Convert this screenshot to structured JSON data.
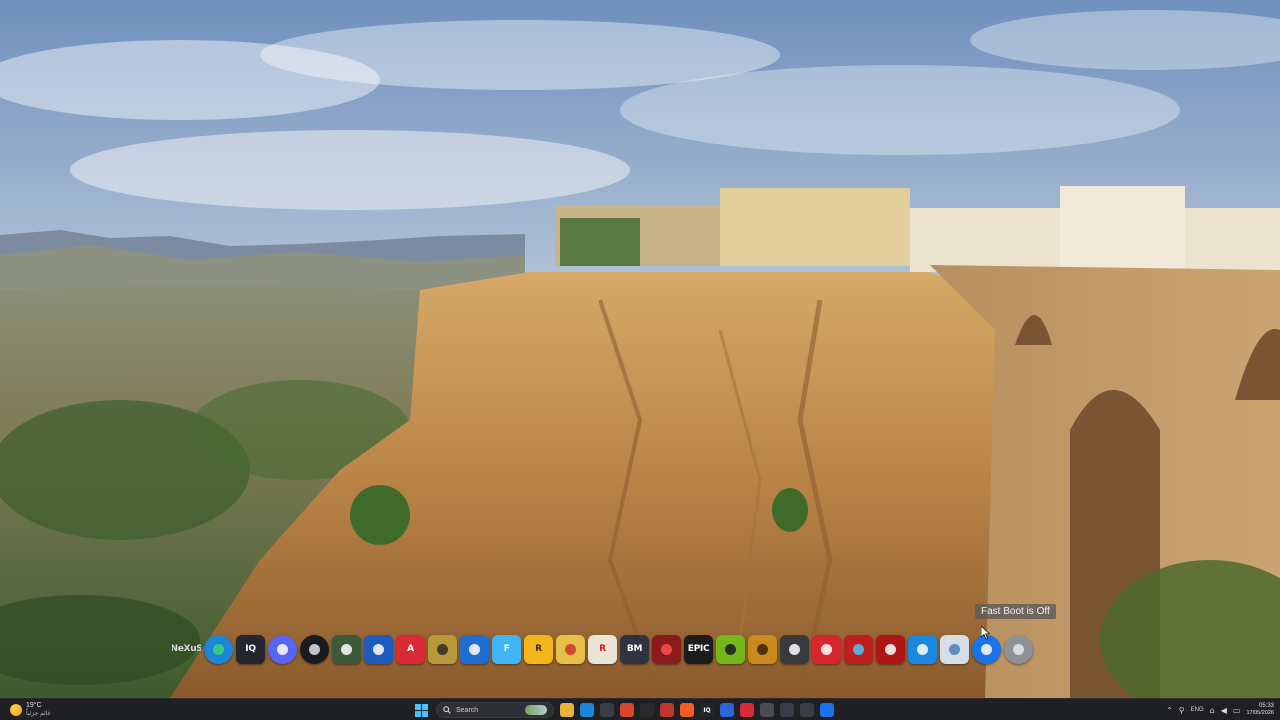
{
  "dock": {
    "tooltip": "Fast Boot is Off",
    "icons": [
      {
        "name": "nexus-logo-icon",
        "label": "NeXuS",
        "bg": "transparent",
        "fg": "#d8d8d8",
        "shape": "plain"
      },
      {
        "name": "edge-browser-icon",
        "label": "",
        "bg": "#1b86d6",
        "fg": "#3fd27a",
        "shape": "round"
      },
      {
        "name": "iq-app-icon",
        "label": "IQ",
        "bg": "#23262c",
        "fg": "#ffffff",
        "shape": "square"
      },
      {
        "name": "discord-icon",
        "label": "",
        "bg": "#5865f2",
        "fg": "#ffffff",
        "shape": "round"
      },
      {
        "name": "obs-studio-icon",
        "label": "",
        "bg": "#1b1b1f",
        "fg": "#e0e0e0",
        "shape": "round"
      },
      {
        "name": "game-mod-app-icon",
        "label": "",
        "bg": "#3d5a3a",
        "fg": "#ffffff",
        "shape": "square"
      },
      {
        "name": "rocket-league-icon",
        "label": "",
        "bg": "#1d5bbd",
        "fg": "#ffffff",
        "shape": "square"
      },
      {
        "name": "acrobat-icon",
        "label": "A",
        "bg": "#d92a35",
        "fg": "#ffffff",
        "shape": "square"
      },
      {
        "name": "game-folder-icon",
        "label": "",
        "bg": "#b79a3b",
        "fg": "#2e2b1c",
        "shape": "square"
      },
      {
        "name": "diagnostic-tool-icon",
        "label": "",
        "bg": "#1f6fd1",
        "fg": "#ffffff",
        "shape": "square"
      },
      {
        "name": "flutter-app-icon",
        "label": "F",
        "bg": "#42b6f5",
        "fg": "#ffffff",
        "shape": "square"
      },
      {
        "name": "r-app-icon",
        "label": "R",
        "bg": "#f2b51b",
        "fg": "#3a2a00",
        "shape": "square"
      },
      {
        "name": "folder-icon",
        "label": "",
        "bg": "#e7c04c",
        "fg": "#c4362b",
        "shape": "square"
      },
      {
        "name": "rockstar-launcher-icon",
        "label": "R",
        "bg": "#e9e4d6",
        "fg": "#c81d1d",
        "shape": "square"
      },
      {
        "name": "bm-app-icon",
        "label": "BM",
        "bg": "#2f3440",
        "fg": "#ffffff",
        "shape": "square"
      },
      {
        "name": "red-mic-icon",
        "label": "",
        "bg": "#8b1a1a",
        "fg": "#ff4d4d",
        "shape": "square"
      },
      {
        "name": "epic-games-icon",
        "label": "EPIC",
        "bg": "#1c1c1c",
        "fg": "#ffffff",
        "shape": "square"
      },
      {
        "name": "nvidia-icon",
        "label": "",
        "bg": "#74b71b",
        "fg": "#1a1a1a",
        "shape": "square"
      },
      {
        "name": "winrar-icon",
        "label": "",
        "bg": "#c98b1e",
        "fg": "#3b2100",
        "shape": "square"
      },
      {
        "name": "cheat-tool-icon",
        "label": "",
        "bg": "#3a3a3e",
        "fg": "#ffffff",
        "shape": "square"
      },
      {
        "name": "red-app-icon",
        "label": "",
        "bg": "#d9262e",
        "fg": "#ffffff",
        "shape": "square"
      },
      {
        "name": "among-us-icon",
        "label": "",
        "bg": "#c01f1f",
        "fg": "#4fc3f7",
        "shape": "square"
      },
      {
        "name": "red-box-icon",
        "label": "",
        "bg": "#b01515",
        "fg": "#ffffff",
        "shape": "square"
      },
      {
        "name": "windows-update-icon",
        "label": "",
        "bg": "#1b87e0",
        "fg": "#ffffff",
        "shape": "square"
      },
      {
        "name": "recycle-bin-icon",
        "label": "",
        "bg": "#d7dde6",
        "fg": "#4a7fb5",
        "shape": "square"
      },
      {
        "name": "chrome-icon",
        "label": "",
        "bg": "#1a73e8",
        "fg": "#ffffff",
        "shape": "round"
      },
      {
        "name": "power-settings-icon",
        "label": "",
        "bg": "#8e9196",
        "fg": "#e8e8e8",
        "shape": "round"
      }
    ]
  },
  "taskbar": {
    "weather_temp": "19°C",
    "weather_condition": "غائم جزئياً",
    "search_placeholder": "Search",
    "pinned": [
      {
        "name": "file-explorer-icon",
        "label": "",
        "bg": "#e8b53a"
      },
      {
        "name": "edge-taskbar-icon",
        "label": "",
        "bg": "#1b86d6"
      },
      {
        "name": "store-icon",
        "label": "",
        "bg": "#3a3d45"
      },
      {
        "name": "office-icon",
        "label": "",
        "bg": "#d9472b"
      },
      {
        "name": "terminal-icon",
        "label": "",
        "bg": "#2a2a2a"
      },
      {
        "name": "media-app-icon",
        "label": "",
        "bg": "#c2352f"
      },
      {
        "name": "brave-browser-icon",
        "label": "",
        "bg": "#f25c24"
      },
      {
        "name": "iq-taskbar-icon",
        "label": "IQ",
        "bg": "#23262c"
      },
      {
        "name": "word-icon",
        "label": "",
        "bg": "#2b66d9"
      },
      {
        "name": "acrobat-taskbar-icon",
        "label": "",
        "bg": "#d92a35"
      },
      {
        "name": "settings-icon",
        "label": "",
        "bg": "#4a4c52"
      },
      {
        "name": "usb-device-icon",
        "label": "",
        "bg": "#3a3d45"
      },
      {
        "name": "app-taskbar-icon",
        "label": "",
        "bg": "#3a3d45"
      },
      {
        "name": "chrome-taskbar-icon",
        "label": "",
        "bg": "#1a73e8"
      }
    ],
    "language": "ENG",
    "clock_time": "05:33",
    "clock_date": "17/05/2026"
  }
}
